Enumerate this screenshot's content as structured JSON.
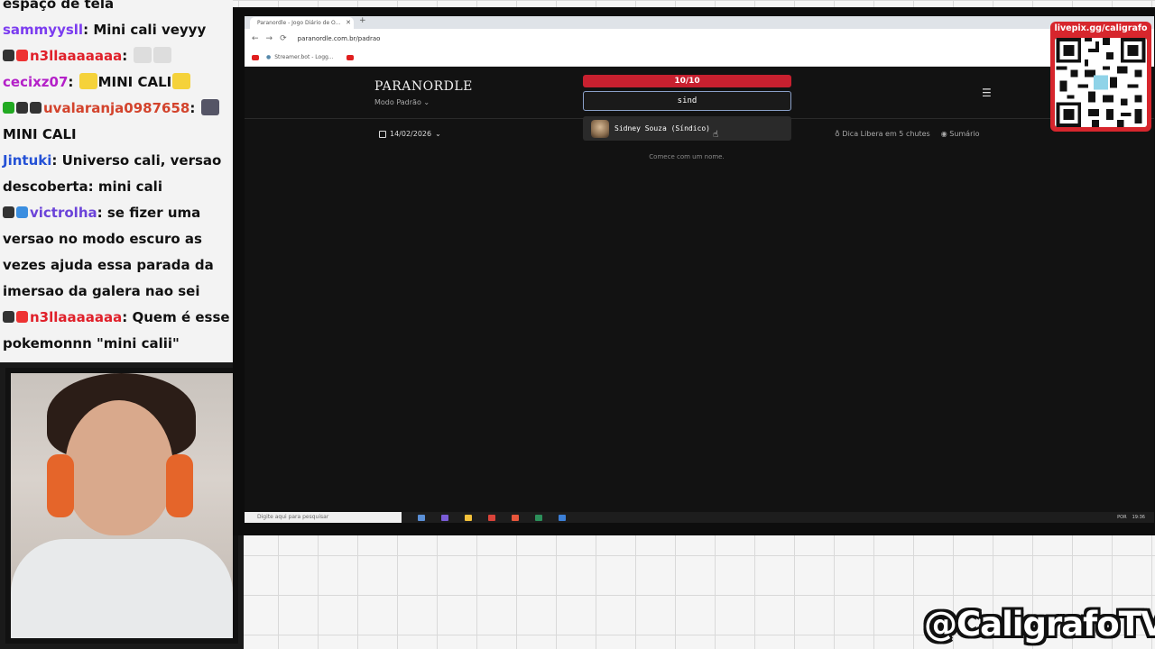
{
  "chat": {
    "messages": [
      {
        "user": "",
        "text": "espaço de tela"
      },
      {
        "user": "sammyysll",
        "text": "Mini cali veyyy"
      },
      {
        "user": "n3llaaaaaaa",
        "text": ""
      },
      {
        "user": "cecixz07",
        "text": "MINI CALI"
      },
      {
        "user": "uvalaranja0987658",
        "text": "MINI CALI"
      },
      {
        "user": "Jintuki",
        "text": "Universo cali, versao descoberta: mini cali"
      },
      {
        "user": "victrolha",
        "text": "se fizer uma versao no modo escuro as vezes ajuda essa parada da imersao da galera nao sei"
      },
      {
        "user": "n3llaaaaaaa",
        "text": "Quem é esse pokemonnn \"mini calii\""
      }
    ]
  },
  "browser": {
    "tab_title": "Paranordle - Jogo Diário de O...",
    "url": "paranordle.com.br/padrao",
    "bookmark": "Streamer.bot - Logg..."
  },
  "app": {
    "logo": "PARANORDLE",
    "mode": "Modo Padrão",
    "counter": "10/10",
    "guess_value": "sind",
    "suggestion": "Sidney Souza (Síndico)",
    "date": "14/02/2026",
    "hint": "Dica Libera em 5 chutes",
    "summary": "Sumário",
    "empty_message": "Comece com um nome."
  },
  "taskbar": {
    "search_placeholder": "Digite aqui para pesquisar",
    "lang": "POR",
    "time": "19:36"
  },
  "overlay": {
    "qr_label": "livepix.gg/caligrafo",
    "channel": "@CaligrafoTV"
  }
}
